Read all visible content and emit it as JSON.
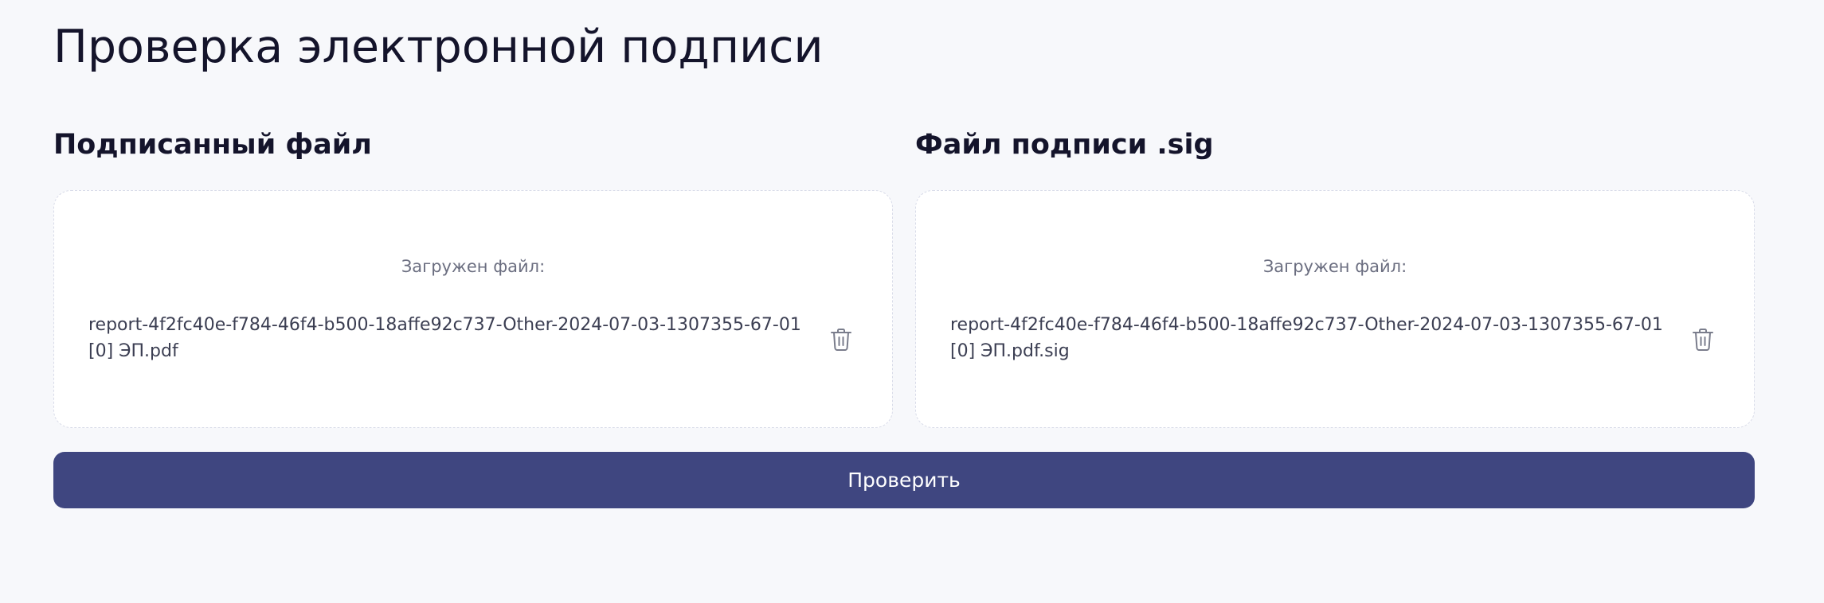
{
  "page": {
    "title": "Проверка электронной подписи"
  },
  "signed_file": {
    "section_title": "Подписанный файл",
    "loaded_label": "Загружен файл:",
    "file_name": "report-4f2fc40e-f784-46f4-b500-18affe92c737-Other-2024-07-03-1307355-67-01[0] ЭП.pdf",
    "delete_icon": "trash-icon"
  },
  "signature_file": {
    "section_title": "Файл подписи .sig",
    "loaded_label": "Загружен файл:",
    "file_name": "report-4f2fc40e-f784-46f4-b500-18affe92c737-Other-2024-07-03-1307355-67-01[0] ЭП.pdf.sig",
    "delete_icon": "trash-icon"
  },
  "actions": {
    "check_label": "Проверить"
  },
  "colors": {
    "background": "#f7f8fb",
    "card": "#ffffff",
    "primary_button": "#3f4680",
    "text_primary": "#14142b",
    "text_secondary": "#6b6e80"
  }
}
